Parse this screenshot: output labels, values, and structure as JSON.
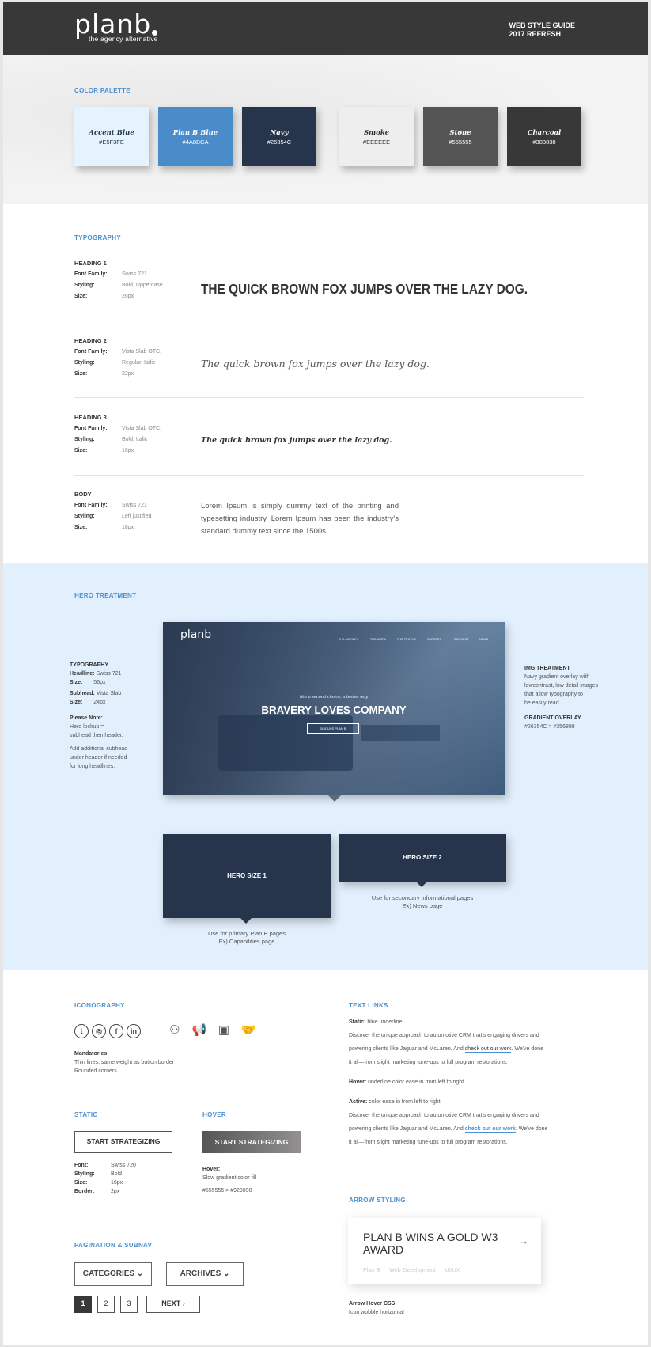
{
  "header": {
    "logo_word": "planb",
    "logo_tagline": "the agency alternative",
    "guide_line1": "WEB STYLE GUIDE",
    "guide_line2": "2017 REFRESH"
  },
  "palette": {
    "label": "COLOR PALETTE",
    "swatches": [
      {
        "name": "Accent Blue",
        "hex": "#E5F3FE",
        "color": "#E5F3FE",
        "text": "#26354C"
      },
      {
        "name": "Plan B Blue",
        "hex": "#4A8BCA",
        "color": "#4A8BCA",
        "text": "#ffffff"
      },
      {
        "name": "Navy",
        "hex": "#26354C",
        "color": "#26354C",
        "text": "#ffffff"
      },
      {
        "name": "Smoke",
        "hex": "#EEEEEE",
        "color": "#EEEEEE",
        "text": "#333333"
      },
      {
        "name": "Stone",
        "hex": "#555555",
        "color": "#555555",
        "text": "#ffffff"
      },
      {
        "name": "Charcoal",
        "hex": "#383838",
        "color": "#383838",
        "text": "#ffffff"
      }
    ]
  },
  "typography": {
    "label": "TYPOGRAPHY",
    "keys": {
      "family": "Font Family:",
      "styling": "Styling:",
      "size": "Size:"
    },
    "rows": [
      {
        "title": "HEADING 1",
        "family": "Swiss 721",
        "styling": "Bold, Uppercase",
        "size": "26px",
        "sample": "THE QUICK BROWN FOX JUMPS OVER THE LAZY DOG."
      },
      {
        "title": "HEADING 2",
        "family": "Vista Slab OTC,",
        "styling": "Regular, Italic",
        "size": "22px",
        "sample": "The quick brown fox jumps over the lazy dog."
      },
      {
        "title": "HEADING 3",
        "family": "Vista Slab OTC,",
        "styling": "Bold, Italic",
        "size": "16px",
        "sample": "The quick brown fox jumps over the lazy dog."
      },
      {
        "title": "BODY",
        "family": "Swiss 721",
        "styling": "Left justified",
        "size": "18px",
        "sample": "Lorem Ipsum is simply dummy text of the printing and typesetting industry. Lorem Ipsum has been the industry's standard dummy text since the 1500s."
      }
    ]
  },
  "hero": {
    "label": "HERO TREATMENT",
    "typo_title": "TYPOGRAPHY",
    "headline_k": "Headline:",
    "headline_v": "Swiss 721",
    "size1_k": "Size:",
    "size1_v": "56px",
    "subhead_k": "Subhead:",
    "subhead_v": "Vista Slab",
    "size2_k": "Size:",
    "size2_v": "24px",
    "note_title": "Please Note:",
    "note1": "Hero lockup =",
    "note2": "subhead then header.",
    "note3": "Add additional subhead",
    "note4": "under header if needed",
    "note5": "for long headlines.",
    "img_title": "IMG TREATMENT",
    "img1": "Navy gradient overlay with",
    "img2": "lowcontrast, low detail images",
    "img3": "that allow typography to",
    "img4": "be easily read",
    "grad_title": "GRADIENT OVERLAY",
    "grad_val": "#26354C > #356898",
    "mock_logo": "planb",
    "mock_nav": [
      "THE AGENCY",
      "THE WORK",
      "THE PEOPLE",
      "CAREERS",
      "CONNECT",
      "NEWS"
    ],
    "mock_sub": "Not a second choice, a better way",
    "mock_head": "BRAVERY LOVES COMPANY",
    "mock_btn": "DISCUSS PLAN B",
    "size1": "HERO SIZE 1",
    "size2": "HERO SIZE 2",
    "cap1a": "Use for primary Plan B pages",
    "cap1b": "Ex) Capabilities page",
    "cap2a": "Use for secondary informational pages",
    "cap2b": "Ex) News page"
  },
  "icons": {
    "label": "ICONOGRAPHY",
    "mandatories_title": "Mandatories:",
    "m1": "Thin lines, same weight as button border",
    "m2": "Rounded corners"
  },
  "buttons": {
    "static_label": "STATIC",
    "hover_label": "HOVER",
    "btn_text": "START STRATEGIZING",
    "font_k": "Font:",
    "font_v": "Swiss 720",
    "styling_k": "Styling:",
    "styling_v": "Bold",
    "size_k": "Size:",
    "size_v": "16px",
    "border_k": "Border:",
    "border_v": "2px",
    "hover_k": "Hover:",
    "hover_v": "Slow gradient color fill",
    "hover_grad": "#555555 > #929090"
  },
  "pagination": {
    "label": "PAGINATION & SUBNAV",
    "categories": "CATEGORIES",
    "archives": "ARCHIVES",
    "pages": [
      "1",
      "2",
      "3"
    ],
    "next": "NEXT"
  },
  "textlinks": {
    "label": "TEXT LINKS",
    "static_k": "Static:",
    "static_v": "blue underline",
    "p1a": "Discover the unique approach to automotive CRM that's engaging drivers and",
    "p1b": "powering clients like Jaguar and McLaren. And ",
    "link1": "check out our work",
    "p1c": ". We've done",
    "p1d": "it all—from slight marketing tune-ups to full program restorations.",
    "hover_k": "Hover:",
    "hover_v": "underline color ease in from left to right",
    "active_k": "Active:",
    "active_v": "color ease in from left to right",
    "link2": "check out our work"
  },
  "arrow": {
    "label": "ARROW STYLING",
    "title1": "PLAN B WINS A GOLD W3",
    "title2": "AWARD",
    "tags": [
      "Plan B",
      "Web Development",
      "UI/UX"
    ],
    "css_k": "Arrow Hover CSS:",
    "css_v": "Icon wobble horizontal"
  }
}
